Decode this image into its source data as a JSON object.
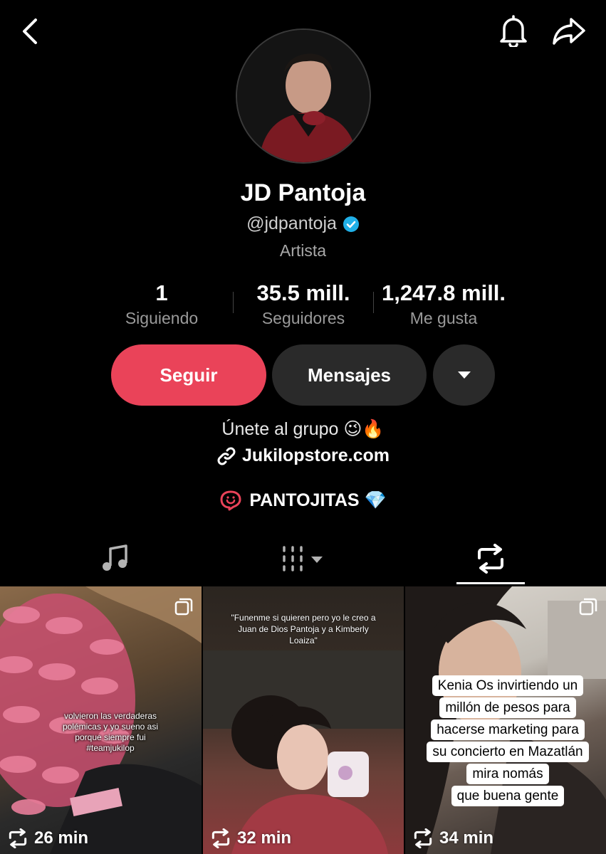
{
  "profile": {
    "name": "JD Pantoja",
    "handle": "@jdpantoja",
    "category": "Artista",
    "verified_color": "#20b0e8"
  },
  "stats": [
    {
      "value": "1",
      "label": "Siguiendo"
    },
    {
      "value": "35.5 mill.",
      "label": "Seguidores"
    },
    {
      "value": "1,247.8 mill.",
      "label": "Me gusta"
    }
  ],
  "actions": {
    "follow": "Seguir",
    "message": "Mensajes",
    "follow_color": "#ea4359"
  },
  "bio": {
    "text": "Únete al grupo 😉🔥",
    "link": "Jukilopstore.com",
    "group": "PANTOJITAS 💎"
  },
  "tabs": {
    "active": "reposts",
    "icons": [
      "music-icon",
      "grid-icon",
      "repost-icon"
    ]
  },
  "videos": [
    {
      "caption": "volvieron las verdaderas polémicas y yo sueno asi porque siempre fui #teamjukilop",
      "time": "26 min"
    },
    {
      "caption": "\"Funenme si quieren pero yo le creo a Juan de Dios Pantoja y a Kimberly Loaiza\"",
      "time": "32 min"
    },
    {
      "caption_lines": [
        "Kenia Os invirtiendo un",
        "millón de pesos para",
        "hacerse marketing para",
        "su concierto en Mazatlán",
        "mira nomás",
        "que buena gente"
      ],
      "time": "34 min"
    }
  ]
}
